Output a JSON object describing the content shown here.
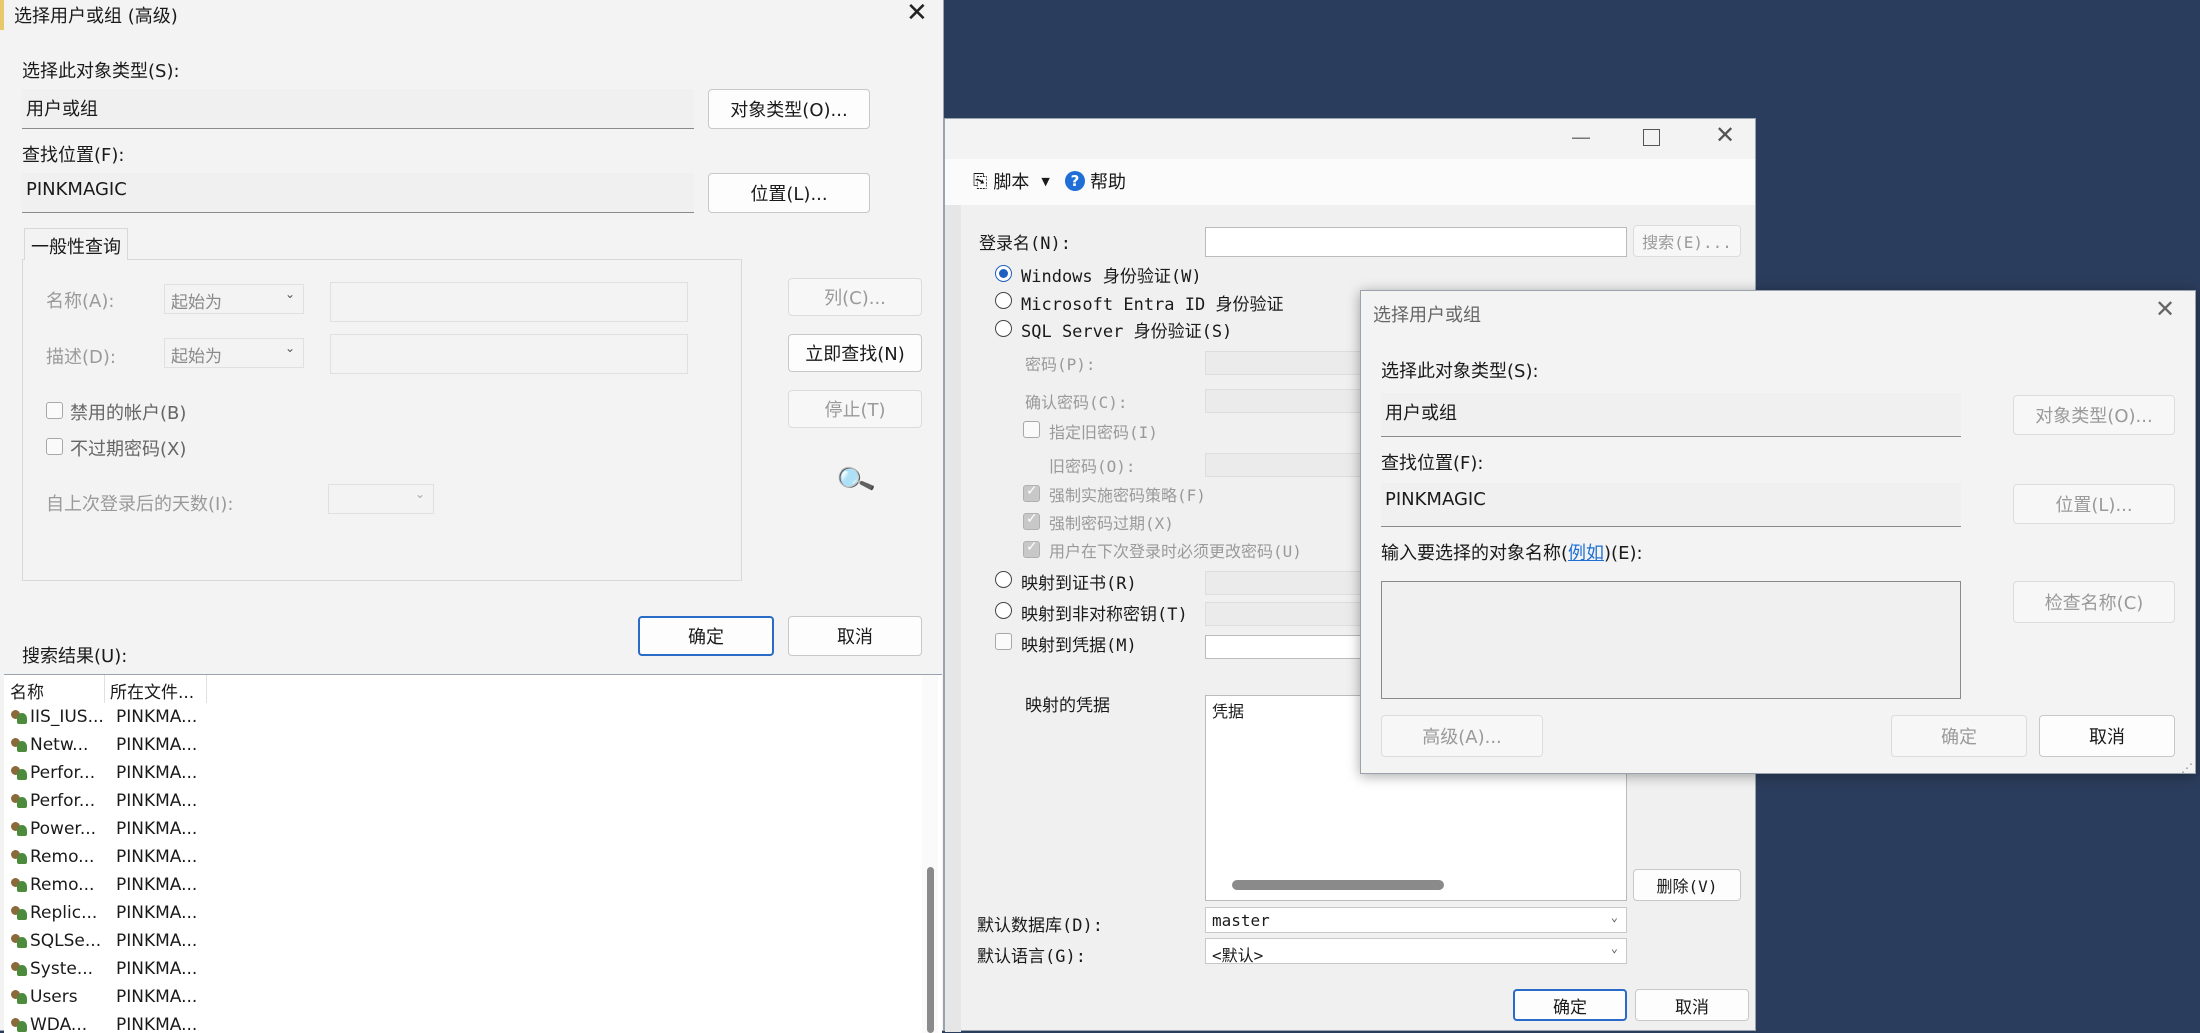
{
  "login_window": {
    "toolbar": {
      "script_label": "脚本",
      "help_label": "帮助"
    },
    "login_name_label": "登录名(N):",
    "search_button": "搜索(E)...",
    "auth_windows": "Windows 身份验证(W)",
    "auth_entra": "Microsoft Entra ID 身份验证",
    "auth_sql": "SQL Server 身份验证(S)",
    "password_label": "密码(P):",
    "confirm_password_label": "确认密码(C):",
    "specify_old_password": "指定旧密码(I)",
    "old_password_label": "旧密码(O):",
    "enforce_policy": "强制实施密码策略(F)",
    "enforce_expiration": "强制密码过期(X)",
    "must_change": "用户在下次登录时必须更改密码(U)",
    "map_certificate": "映射到证书(R)",
    "map_asym_key": "映射到非对称密钥(T)",
    "map_credential": "映射到凭据(M)",
    "mapped_credentials_label": "映射的凭据",
    "credential_column": "凭据",
    "remove_button": "删除(V)",
    "default_db_label": "默认数据库(D):",
    "default_db_value": "master",
    "default_lang_label": "默认语言(G):",
    "default_lang_value": "<默认>",
    "ok_button": "确定",
    "cancel_button": "取消"
  },
  "select_small": {
    "title": "选择用户或组",
    "object_type_label": "选择此对象类型(S):",
    "object_type_value": "用户或组",
    "object_types_button": "对象类型(O)...",
    "location_label": "查找位置(F):",
    "location_value": "PINKMAGIC",
    "location_button": "位置(L)...",
    "enter_names_prefix": "输入要选择的对象名称(",
    "examples_link": "例如",
    "enter_names_suffix": ")(E):",
    "check_names_button": "检查名称(C)",
    "advanced_button": "高级(A)...",
    "ok_button": "确定",
    "cancel_button": "取消"
  },
  "select_advanced": {
    "title": "选择用户或组 (高级)",
    "object_type_label": "选择此对象类型(S):",
    "object_type_value": "用户或组",
    "object_types_button": "对象类型(O)...",
    "location_label": "查找位置(F):",
    "location_value": "PINKMAGIC",
    "location_button": "位置(L)...",
    "common_queries_tab": "一般性查询",
    "name_label": "名称(A):",
    "name_mode": "起始为",
    "desc_label": "描述(D):",
    "desc_mode": "起始为",
    "disabled_accounts": "禁用的帐户(B)",
    "non_expiring_pw": "不过期密码(X)",
    "days_since_login": "自上次登录后的天数(I):",
    "columns_button": "列(C)...",
    "find_now_button": "立即查找(N)",
    "stop_button": "停止(T)",
    "ok_button": "确定",
    "cancel_button": "取消",
    "results_label": "搜索结果(U):",
    "results_headers": [
      "名称",
      "所在文件..."
    ],
    "results": [
      [
        "IIS_IUS...",
        "PINKMA..."
      ],
      [
        "Netw...",
        "PINKMA..."
      ],
      [
        "Perfor...",
        "PINKMA..."
      ],
      [
        "Perfor...",
        "PINKMA..."
      ],
      [
        "Power...",
        "PINKMA..."
      ],
      [
        "Remo...",
        "PINKMA..."
      ],
      [
        "Remo...",
        "PINKMA..."
      ],
      [
        "Replic...",
        "PINKMA..."
      ],
      [
        "SQLSe...",
        "PINKMA..."
      ],
      [
        "Syste...",
        "PINKMA..."
      ],
      [
        "Users",
        "PINKMA..."
      ],
      [
        "WDA...",
        "PINKMA..."
      ]
    ]
  }
}
